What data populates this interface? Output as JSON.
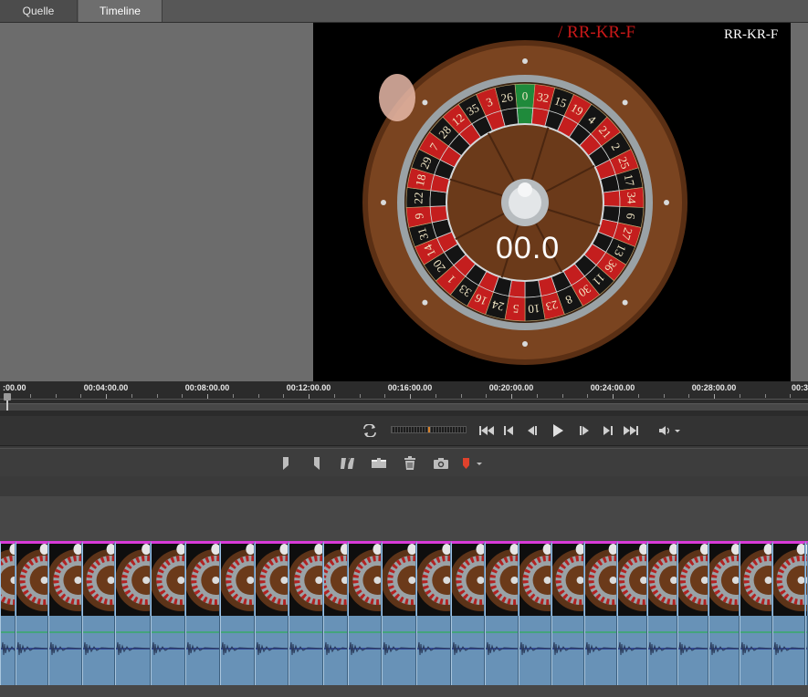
{
  "tabs": [
    {
      "label": "Quelle",
      "active": false
    },
    {
      "label": "Timeline",
      "active": true
    }
  ],
  "monitor": {
    "watermark_red": "/ RR-KR-F",
    "watermark_white": "RR-KR-F",
    "timecode_overlay": "00.0",
    "wheel_numbers": [
      "0",
      "32",
      "15",
      "19",
      "4",
      "21",
      "2",
      "25",
      "17",
      "34",
      "6",
      "27",
      "13",
      "36",
      "11",
      "30",
      "8",
      "23",
      "10",
      "5",
      "24",
      "16",
      "33",
      "1",
      "20",
      "14",
      "31",
      "9",
      "22",
      "18",
      "29",
      "7",
      "28",
      "12",
      "35",
      "3",
      "26"
    ]
  },
  "ruler": {
    "labels": [
      ":00.00",
      "00:04:00.00",
      "00:08:00.00",
      "00:12:00.00",
      "00:16:00.00",
      "00:20:00.00",
      "00:24:00.00",
      "00:28:00.00",
      "00:3"
    ]
  },
  "transport": {
    "icons": [
      "loop-icon",
      "jog-shuttle",
      "go-to-start-icon",
      "previous-edit-icon",
      "step-back-icon",
      "play-icon",
      "step-forward-icon",
      "next-edit-icon",
      "go-to-end-icon",
      "volume-icon"
    ]
  },
  "editbar": {
    "icons": [
      "mark-in-icon",
      "mark-out-icon",
      "split-clip-icon",
      "insert-icon",
      "delete-icon",
      "snapshot-icon",
      "marker-icon"
    ]
  },
  "colors": {
    "marker": "#e0422c",
    "clip_top": "#d83ad8",
    "audio_fill": "#6892b7",
    "audio_green_line": "#2fae5a",
    "audio_wave": "#22328a"
  }
}
